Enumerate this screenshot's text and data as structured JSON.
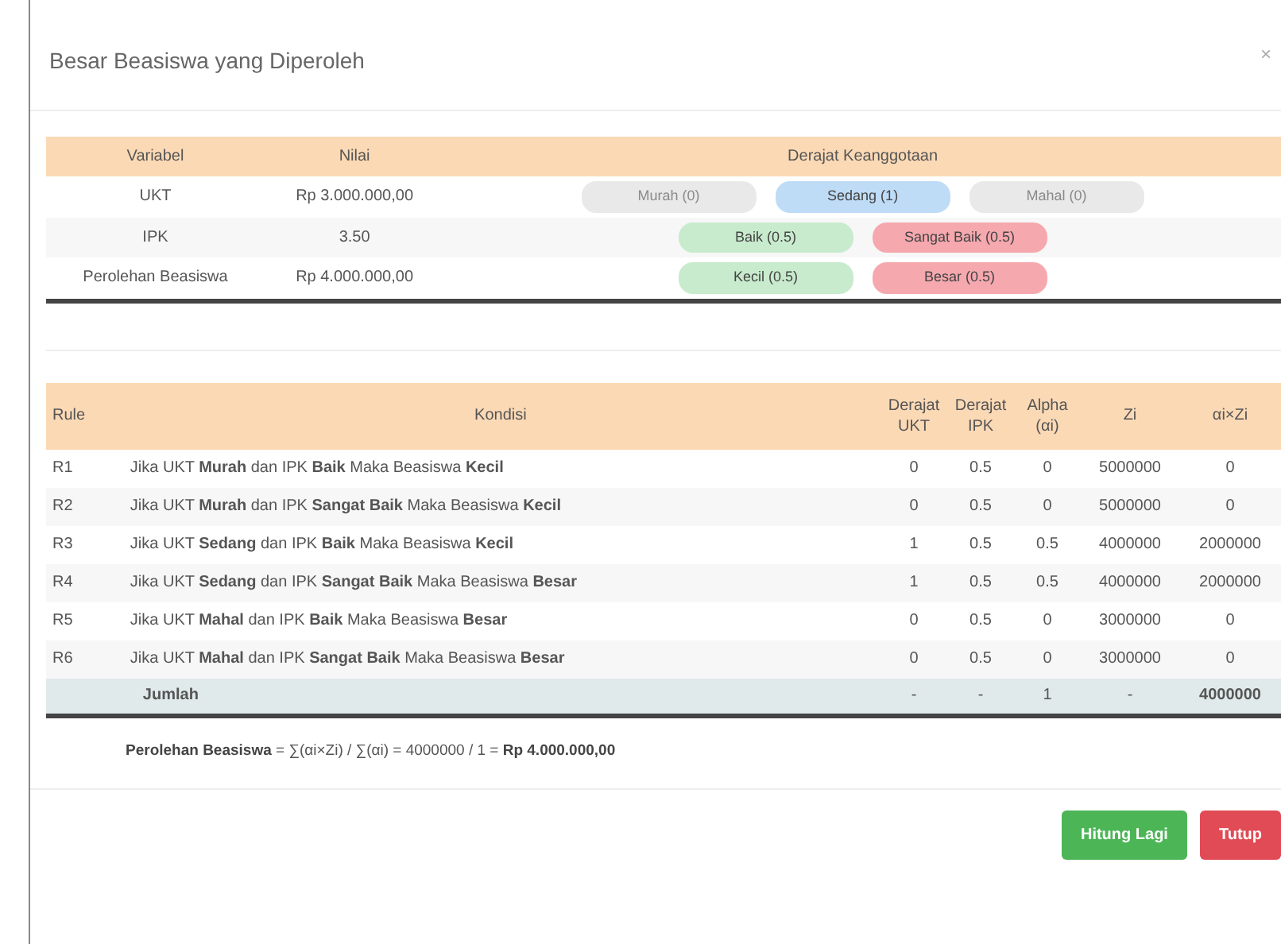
{
  "modal": {
    "title": "Besar Beasiswa yang Diperoleh",
    "close": "×"
  },
  "membership_table": {
    "columns": [
      "Variabel",
      "Nilai",
      "Derajat Keanggotaan"
    ],
    "rows": [
      {
        "variable": "UKT",
        "value": "Rp 3.000.000,00",
        "badges": [
          {
            "label": "Murah (0)",
            "color": "#e9e9e9",
            "active": false
          },
          {
            "label": "Sedang (1)",
            "color": "#bfdcf7",
            "active": true
          },
          {
            "label": "Mahal (0)",
            "color": "#e9e9e9",
            "active": false
          }
        ]
      },
      {
        "variable": "IPK",
        "value": "3.50",
        "badges": [
          {
            "label": "Baik (0.5)",
            "color": "#c8ebcd",
            "active": true
          },
          {
            "label": "Sangat Baik (0.5)",
            "color": "#f5a8ae",
            "active": true
          }
        ]
      },
      {
        "variable": "Perolehan Beasiswa",
        "value": "Rp 4.000.000,00",
        "badges": [
          {
            "label": "Kecil (0.5)",
            "color": "#c8ebcd",
            "active": true
          },
          {
            "label": "Besar (0.5)",
            "color": "#f5a8ae",
            "active": true
          }
        ]
      }
    ]
  },
  "rules_table": {
    "columns": [
      "Rule",
      "Kondisi",
      "Derajat UKT",
      "Derajat IPK",
      "Alpha (αi)",
      "Zi",
      "αi×Zi"
    ],
    "rows": [
      {
        "kind": "rule",
        "cells": [
          "R1",
          "Jika UKT **Murah** dan IPK **Baik** Maka Beasiswa **Kecil**",
          "0",
          "0.5",
          "0",
          "5000000",
          "0"
        ]
      },
      {
        "kind": "rule",
        "cells": [
          "R2",
          "Jika UKT **Murah** dan IPK **Sangat Baik** Maka Beasiswa **Kecil**",
          "0",
          "0.5",
          "0",
          "5000000",
          "0"
        ]
      },
      {
        "kind": "rule",
        "cells": [
          "R3",
          "Jika UKT **Sedang** dan IPK **Baik** Maka Beasiswa **Kecil**",
          "1",
          "0.5",
          "0.5",
          "4000000",
          "2000000"
        ]
      },
      {
        "kind": "rule",
        "cells": [
          "R4",
          "Jika UKT **Sedang** dan IPK **Sangat Baik** Maka Beasiswa **Besar**",
          "1",
          "0.5",
          "0.5",
          "4000000",
          "2000000"
        ]
      },
      {
        "kind": "rule",
        "cells": [
          "R5",
          "Jika UKT **Mahal** dan IPK **Baik** Maka Beasiswa **Besar**",
          "0",
          "0.5",
          "0",
          "3000000",
          "0"
        ]
      },
      {
        "kind": "rule",
        "cells": [
          "R6",
          "Jika UKT **Mahal** dan IPK **Sangat Baik** Maka Beasiswa **Besar**",
          "0",
          "0.5",
          "0",
          "3000000",
          "0"
        ]
      },
      {
        "kind": "total",
        "cells": [
          "",
          "Jumlah",
          "-",
          "-",
          "1",
          "-",
          "4000000"
        ]
      }
    ]
  },
  "formula": "**Perolehan Beasiswa** = ∑(αi×Zi) / ∑(αi) = 4000000 / 1 = **Rp 4.000.000,00**",
  "buttons": [
    {
      "label": "Hitung Lagi",
      "kind": "success"
    },
    {
      "label": "Tutup",
      "kind": "danger"
    }
  ]
}
